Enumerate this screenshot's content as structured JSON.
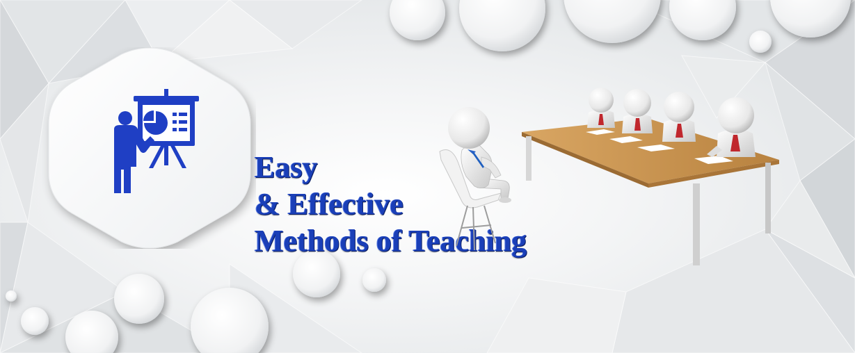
{
  "headline": {
    "line1": "Easy",
    "line2": "& Effective",
    "line3": "Methods of Teaching"
  },
  "icons": {
    "badge": "teacher-presentation-icon",
    "illustration": "teacher-and-students-meeting-illustration"
  },
  "colors": {
    "headline": "#1a3fb8",
    "icon": "#1f3fc4",
    "table_top": "#c9914f",
    "background": "#f4f5f6"
  }
}
